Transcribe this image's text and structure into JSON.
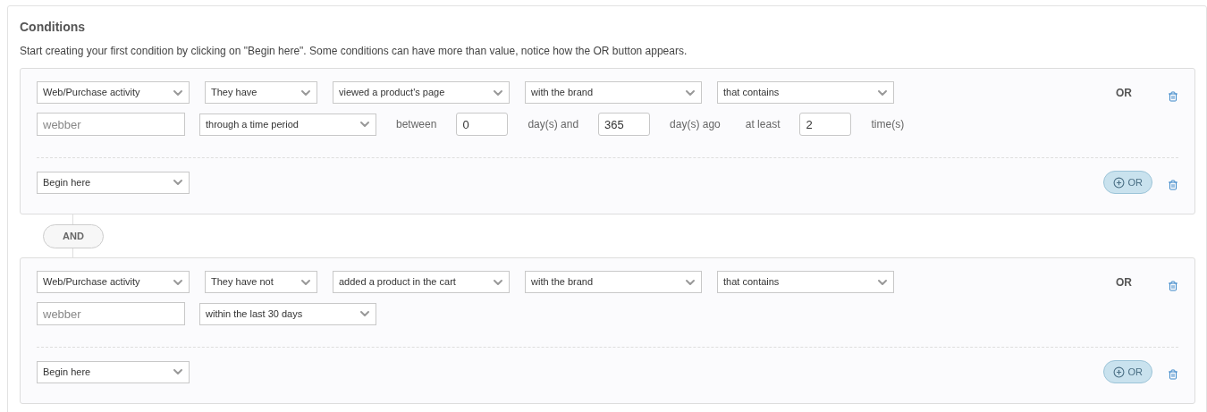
{
  "title": "Conditions",
  "description": "Start creating your first condition by clicking on \"Begin here\". Some conditions can have more than value, notice how the OR button appears.",
  "joiner": "AND",
  "groups": [
    {
      "selects": [
        "Web/Purchase activity",
        "They have",
        "viewed a product's page",
        "with the brand",
        "that contains"
      ],
      "or_label": "OR",
      "details": [
        {
          "kind": "input",
          "placeholder": "webber"
        },
        {
          "kind": "select",
          "value": "through a time period"
        },
        {
          "kind": "text",
          "text": "between"
        },
        {
          "kind": "number",
          "value": "0"
        },
        {
          "kind": "text",
          "text": "day(s) and"
        },
        {
          "kind": "number",
          "value": "365"
        },
        {
          "kind": "text",
          "text": "day(s) ago"
        },
        {
          "kind": "text",
          "text": "at least"
        },
        {
          "kind": "number",
          "value": "2"
        },
        {
          "kind": "text",
          "text": "time(s)"
        }
      ],
      "begin": "Begin here",
      "or_button": "OR"
    },
    {
      "selects": [
        "Web/Purchase activity",
        "They have not",
        "added a product in the cart",
        "with the brand",
        "that contains"
      ],
      "or_label": "OR",
      "details": [
        {
          "kind": "input",
          "placeholder": "webber"
        },
        {
          "kind": "select",
          "value": "within the last 30 days"
        }
      ],
      "begin": "Begin here",
      "or_button": "OR"
    }
  ]
}
